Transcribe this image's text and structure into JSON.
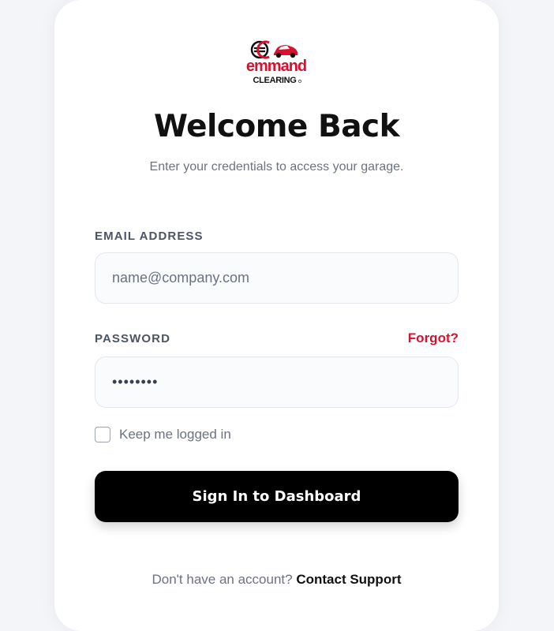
{
  "brand": {
    "logo_icon": "emmand-clearing-logo",
    "logo_top_text": "emmand",
    "logo_bottom_text": "CLEARING",
    "accent_color": "#d8112e"
  },
  "header": {
    "title": "Welcome Back",
    "subtitle": "Enter your credentials to access your garage."
  },
  "form": {
    "email_label": "EMAIL ADDRESS",
    "email_placeholder": "name@company.com",
    "password_label": "PASSWORD",
    "forgot_label": "Forgot?",
    "password_value": "••••••••",
    "remember_label": "Keep me logged in",
    "remember_checked": false,
    "submit_label": "Sign In to Dashboard"
  },
  "footer": {
    "prompt": "Don't have an account?",
    "link_label": "Contact Support"
  }
}
